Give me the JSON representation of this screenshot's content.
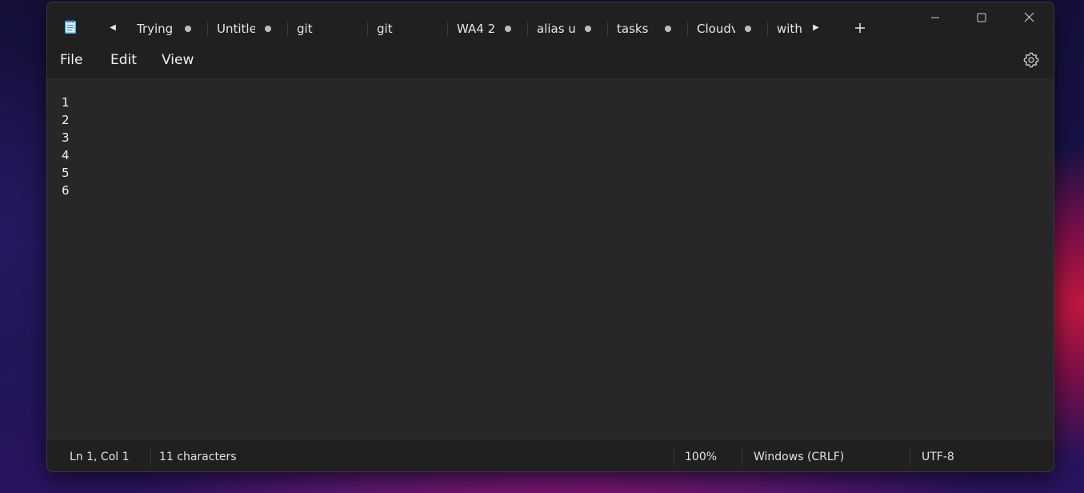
{
  "tabs": [
    {
      "label": "Trying",
      "unsaved": true
    },
    {
      "label": "Untitle",
      "unsaved": true
    },
    {
      "label": "git",
      "unsaved": false
    },
    {
      "label": "git",
      "unsaved": false
    },
    {
      "label": "WA4 2",
      "unsaved": true
    },
    {
      "label": "alias u",
      "unsaved": true
    },
    {
      "label": "tasks",
      "unsaved": true
    },
    {
      "label": "Cloudv",
      "unsaved": true
    },
    {
      "label": "with",
      "unsaved": false
    }
  ],
  "menu": {
    "file": "File",
    "edit": "Edit",
    "view": "View"
  },
  "editor": {
    "line_numbers": [
      "1",
      "2",
      "3",
      "4",
      "5",
      "6"
    ]
  },
  "status": {
    "position": "Ln 1, Col 1",
    "characters": "11 characters",
    "zoom": "100%",
    "line_endings": "Windows (CRLF)",
    "encoding": "UTF-8"
  },
  "icons": {
    "app": "notepad-icon",
    "scroll_left": "scroll-left-icon",
    "scroll_right": "scroll-right-icon",
    "new_tab": "plus-icon",
    "minimize": "minimize-icon",
    "maximize": "maximize-icon",
    "close": "close-icon",
    "settings": "gear-icon"
  },
  "colors": {
    "window_bg": "#272727",
    "chrome_bg": "#202020",
    "text": "#f0f0f0"
  }
}
